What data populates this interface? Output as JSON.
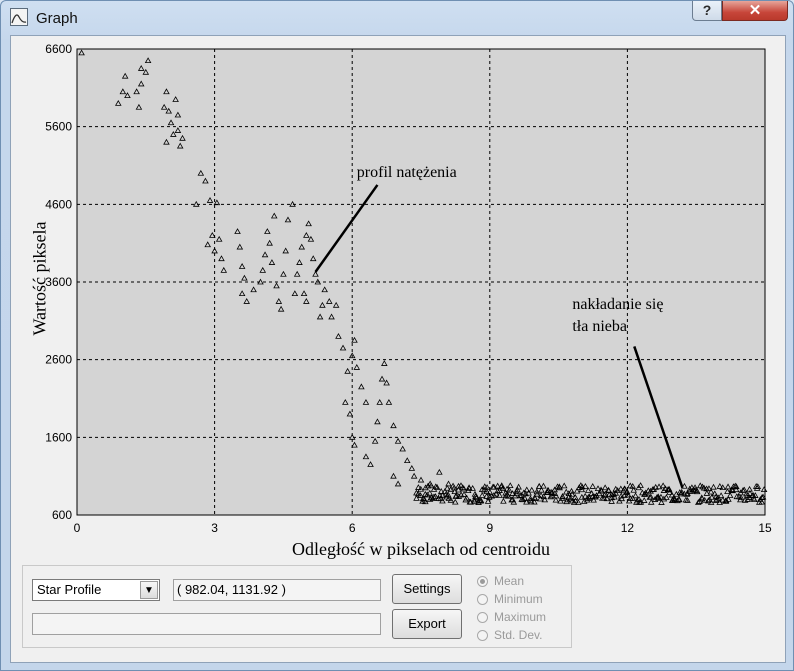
{
  "window": {
    "title": "Graph",
    "help_label": "?",
    "close_label": "✕",
    "icon": "graph-window-icon"
  },
  "chart_data": {
    "type": "scatter",
    "title": "",
    "xlabel": "Odległość w pikselach od centroidu",
    "ylabel": "Wartość piksela",
    "xlim": [
      0,
      15
    ],
    "ylim": [
      600,
      6600
    ],
    "x_ticks": [
      "0",
      "3",
      "6",
      "9",
      "12",
      "15"
    ],
    "y_ticks": [
      "600",
      "1600",
      "2600",
      "3600",
      "4600",
      "5600",
      "6600"
    ],
    "grid": true,
    "marker": "triangle",
    "background": "#d4d4d4",
    "annotations": [
      {
        "text": "profil natężenia",
        "x": 6.1,
        "y": 4950
      },
      {
        "text": "nakładanie się",
        "x": 10.8,
        "y": 3250
      },
      {
        "text": "tła nieba",
        "x": 10.8,
        "y": 2970
      }
    ],
    "points": [
      [
        0.1,
        6550
      ],
      [
        0.9,
        5900
      ],
      [
        1.0,
        6050
      ],
      [
        1.1,
        6000
      ],
      [
        1.05,
        6250
      ],
      [
        1.3,
        6050
      ],
      [
        1.35,
        5850
      ],
      [
        1.4,
        6150
      ],
      [
        1.5,
        6300
      ],
      [
        1.55,
        6450
      ],
      [
        1.4,
        6350
      ],
      [
        1.9,
        5850
      ],
      [
        1.95,
        6050
      ],
      [
        2.0,
        5800
      ],
      [
        2.05,
        5650
      ],
      [
        2.1,
        5500
      ],
      [
        2.15,
        5950
      ],
      [
        2.2,
        5550
      ],
      [
        2.25,
        5350
      ],
      [
        2.2,
        5750
      ],
      [
        2.3,
        5450
      ],
      [
        1.95,
        5400
      ],
      [
        2.7,
        5000
      ],
      [
        2.8,
        4900
      ],
      [
        2.9,
        4650
      ],
      [
        2.6,
        4600
      ],
      [
        3.05,
        4620
      ],
      [
        2.85,
        4080
      ],
      [
        3.0,
        4000
      ],
      [
        2.95,
        4200
      ],
      [
        3.15,
        3900
      ],
      [
        3.2,
        3750
      ],
      [
        3.1,
        4150
      ],
      [
        3.5,
        4250
      ],
      [
        3.55,
        4050
      ],
      [
        3.6,
        3800
      ],
      [
        3.65,
        3650
      ],
      [
        3.6,
        3450
      ],
      [
        3.7,
        3350
      ],
      [
        3.85,
        3500
      ],
      [
        4.0,
        3600
      ],
      [
        4.05,
        3750
      ],
      [
        4.1,
        3950
      ],
      [
        4.2,
        4100
      ],
      [
        4.3,
        4450
      ],
      [
        4.15,
        4250
      ],
      [
        4.25,
        3850
      ],
      [
        4.35,
        3550
      ],
      [
        4.4,
        3350
      ],
      [
        4.45,
        3250
      ],
      [
        4.5,
        3700
      ],
      [
        4.55,
        4000
      ],
      [
        4.6,
        4400
      ],
      [
        4.7,
        4600
      ],
      [
        4.75,
        3450
      ],
      [
        4.8,
        3700
      ],
      [
        4.85,
        3850
      ],
      [
        4.9,
        4050
      ],
      [
        5.0,
        4200
      ],
      [
        5.05,
        4350
      ],
      [
        5.1,
        4150
      ],
      [
        5.15,
        3900
      ],
      [
        5.2,
        3700
      ],
      [
        4.95,
        3450
      ],
      [
        5.0,
        3350
      ],
      [
        5.25,
        3600
      ],
      [
        5.3,
        3150
      ],
      [
        5.35,
        3300
      ],
      [
        5.4,
        3500
      ],
      [
        5.5,
        3350
      ],
      [
        5.55,
        3150
      ],
      [
        5.65,
        3300
      ],
      [
        5.7,
        2900
      ],
      [
        5.8,
        2750
      ],
      [
        5.9,
        2450
      ],
      [
        6.0,
        2650
      ],
      [
        6.05,
        2850
      ],
      [
        6.1,
        2500
      ],
      [
        6.2,
        2250
      ],
      [
        6.3,
        2050
      ],
      [
        5.85,
        2050
      ],
      [
        5.95,
        1900
      ],
      [
        6.0,
        1600
      ],
      [
        6.05,
        1500
      ],
      [
        6.3,
        1350
      ],
      [
        6.4,
        1250
      ],
      [
        6.5,
        1550
      ],
      [
        6.55,
        1800
      ],
      [
        6.6,
        2050
      ],
      [
        6.65,
        2350
      ],
      [
        6.7,
        2550
      ],
      [
        6.75,
        2300
      ],
      [
        6.8,
        2050
      ],
      [
        6.9,
        1750
      ],
      [
        7.0,
        1550
      ],
      [
        7.1,
        1450
      ],
      [
        7.2,
        1300
      ],
      [
        7.3,
        1200
      ],
      [
        7.35,
        1100
      ],
      [
        7.0,
        1000
      ],
      [
        6.9,
        1100
      ],
      [
        7.5,
        1050
      ],
      [
        7.6,
        950
      ],
      [
        7.7,
        1000
      ],
      [
        7.9,
        1150
      ],
      [
        8.1,
        1000
      ]
    ],
    "noise": {
      "x_start": 7.4,
      "x_end": 15.0,
      "count": 360,
      "y_mean": 870,
      "y_spread": 110
    }
  },
  "controls": {
    "profile_select": "Star Profile",
    "coordinates": "( 982.04, 1131.92 )",
    "status_value": "",
    "settings_label": "Settings",
    "export_label": "Export",
    "radio_options": [
      "Mean",
      "Minimum",
      "Maximum",
      "Std. Dev."
    ],
    "radio_selected": "Mean"
  }
}
